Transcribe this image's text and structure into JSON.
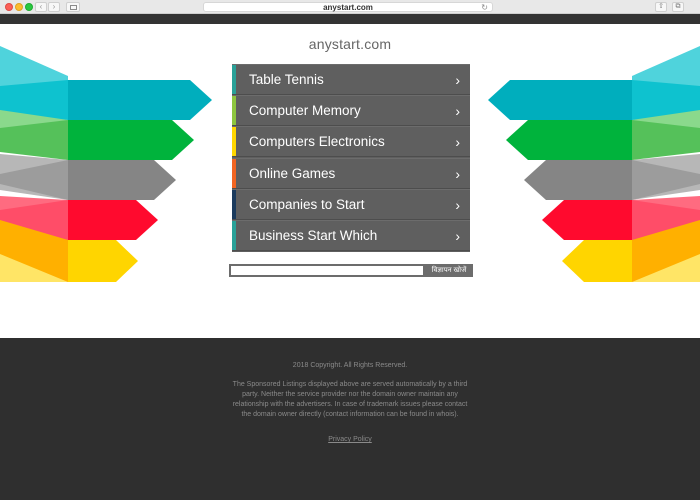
{
  "browser": {
    "address": "anystart.com",
    "back_icon": "‹",
    "forward_icon": "›",
    "reload_icon": "↻",
    "share_icon": "⇧",
    "tabs_icon": "⧉"
  },
  "site": {
    "title": "anystart.com"
  },
  "menu": {
    "items": [
      {
        "label": "Table Tennis",
        "accent": "#2aa198"
      },
      {
        "label": "Computer Memory",
        "accent": "#8dc63f"
      },
      {
        "label": "Computers Electronics",
        "accent": "#ffd700"
      },
      {
        "label": "Online Games",
        "accent": "#f26522"
      },
      {
        "label": "Companies to Start",
        "accent": "#1b3a5c"
      },
      {
        "label": "Business Start Which",
        "accent": "#2aa198"
      }
    ],
    "chevron": "›"
  },
  "search": {
    "value": "",
    "button_label": "विज्ञापन खोजें"
  },
  "footer": {
    "copyright": "2018 Copyright. All Rights Reserved.",
    "disclaimer": "The Sponsored Listings displayed above are served automatically by a third party. Neither the service provider nor the domain owner maintain any relationship with the advertisers. In case of trademark issues please contact the domain owner directly (contact information can be found in whois).",
    "privacy": "Privacy Policy"
  },
  "colors": {
    "cyan": "#00aebd",
    "green": "#00b33c",
    "gray": "#858585",
    "red": "#ff0a2e",
    "yellow": "#ffd500"
  }
}
